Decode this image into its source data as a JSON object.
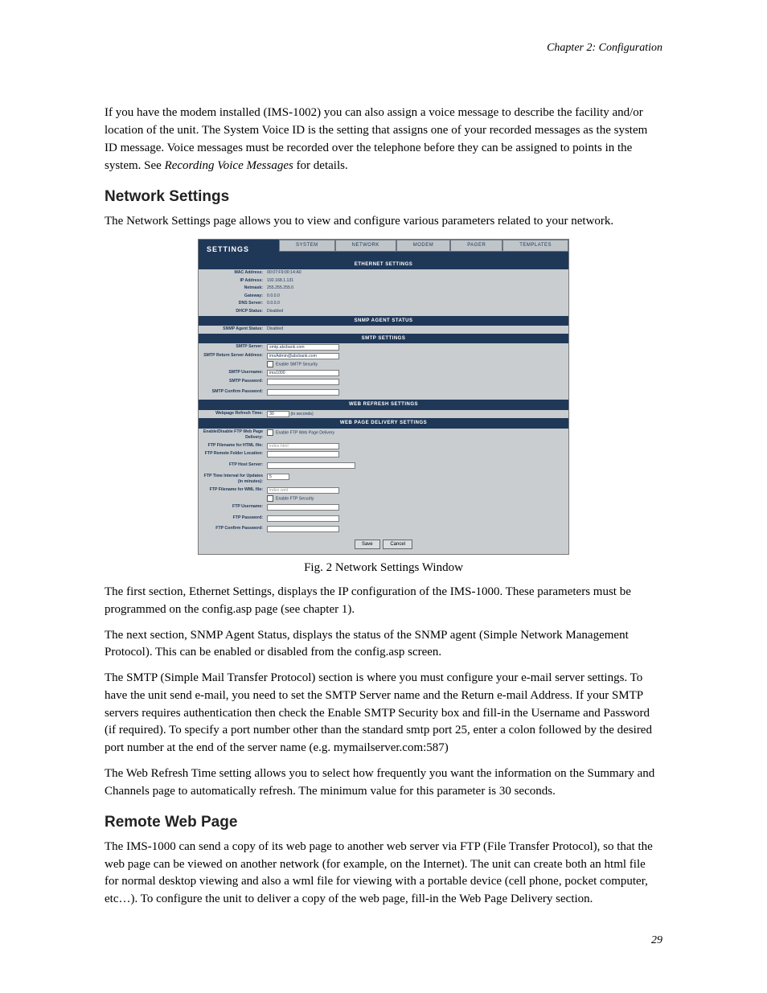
{
  "chapter": "Chapter 2: Configuration",
  "intro_para": "If you have the modem installed (IMS-1002) you can also assign a voice message to describe the facility and/or location of the unit. The System Voice ID is the setting that assigns one of your recorded messages as the system ID message. Voice messages must be recorded over the telephone before they can be assigned to points in the system. See ",
  "intro_em": "Recording Voice Messages",
  "intro_tail": " for details.",
  "h_network": "Network Settings",
  "network_p1": "The Network Settings page allows you to view and configure various parameters related to your network.",
  "fig_caption": "Fig. 2 Network Settings Window",
  "p_eth": "The first section, Ethernet Settings, displays the IP configuration of the IMS-1000. These parameters must be programmed on the config.asp page (see chapter 1).",
  "p_snmp": "The next section, SNMP Agent Status, displays the status of the SNMP agent (Simple Network Management Protocol). This can be enabled or disabled from the config.asp screen.",
  "p_smtp": "The SMTP (Simple Mail Transfer Protocol) section is where you must configure your e-mail server settings. To have the unit send e-mail, you need to set the SMTP Server name and the Return e-mail Address. If your SMTP servers requires authentication then check the Enable SMTP Security box and fill-in the Username and Password (if required). To specify a port number other than the standard smtp port 25, enter a colon followed by the desired port number at the end of the server name (e.g. mymailserver.com:587)",
  "p_web": "The Web Refresh Time setting allows you to select how frequently you want the information on the Summary and Channels page to automatically refresh. The minimum value for this parameter is 30 seconds.",
  "h_remote": "Remote Web Page",
  "p_remote": "The IMS-1000 can send a copy of its web page to another web server via FTP (File Transfer Protocol), so that the web page can be viewed on another network (for example, on the Internet). The unit can create both an html file for normal desktop viewing and also a wml file for viewing with a portable device (cell phone, pocket computer, etc…). To configure the unit to deliver a copy of the web page, fill-in the Web Page Delivery section.",
  "page_num": "29",
  "ss": {
    "title": "SETTINGS",
    "tabs": [
      "SYSTEM",
      "NETWORK",
      "MODEM",
      "PAGER",
      "TEMPLATES"
    ],
    "sec_eth": "ETHERNET SETTINGS",
    "eth": {
      "mac_l": "MAC Address:",
      "mac_v": "00:07:F9:00:14:A0",
      "ip_l": "IP Address:",
      "ip_v": "192.168.1.131",
      "nm_l": "Netmask:",
      "nm_v": "255.255.255.0",
      "gw_l": "Gateway:",
      "gw_v": "0.0.0.0",
      "dns_l": "DNS Server:",
      "dns_v": "0.0.0.0",
      "dhcp_l": "DHCP Status:",
      "dhcp_v": "Disabled"
    },
    "sec_snmp": "SNMP AGENT STATUS",
    "snmp": {
      "l": "SNMP Agent Status:",
      "v": "Disabled"
    },
    "sec_smtp": "SMTP SETTINGS",
    "smtp": {
      "srv_l": "SMTP Server:",
      "srv_v": "smtp.abcbank.com",
      "ret_l": "SMTP Return Server Address:",
      "ret_v": "imsAdmin@abcbank.com",
      "sec_chk": "Enable SMTP Security",
      "user_l": "SMTP Username:",
      "user_v": "ims1000",
      "pwd_l": "SMTP Password:",
      "cpwd_l": "SMTP Confirm Password:"
    },
    "sec_webr": "WEB REFRESH SETTINGS",
    "webr": {
      "l": "Webpage Refresh Time:",
      "v": "30",
      "u": "(in seconds)"
    },
    "sec_wpd": "WEB PAGE DELIVERY SETTINGS",
    "wpd": {
      "en_l": "Enable/Disable FTP Web Page Delivery:",
      "en_chk": "Enable FTP Web Page Delivery",
      "html_l": "FTP Filename for HTML file:",
      "html_ph": "index.html",
      "loc_l": "FTP Remote Folder Location:",
      "host_l": "FTP Host Server:",
      "int_l": "FTP Time Interval for Updates (in minutes):",
      "int_v": "5",
      "wml_l": "FTP Filename for WML file:",
      "wml_ph": "index.wml",
      "sec_chk": "Enable FTP Security",
      "user_l": "FTP Username:",
      "pwd_l": "FTP Password:",
      "cpwd_l": "FTP Confirm Password:"
    },
    "btn_save": "Save",
    "btn_cancel": "Cancel"
  }
}
